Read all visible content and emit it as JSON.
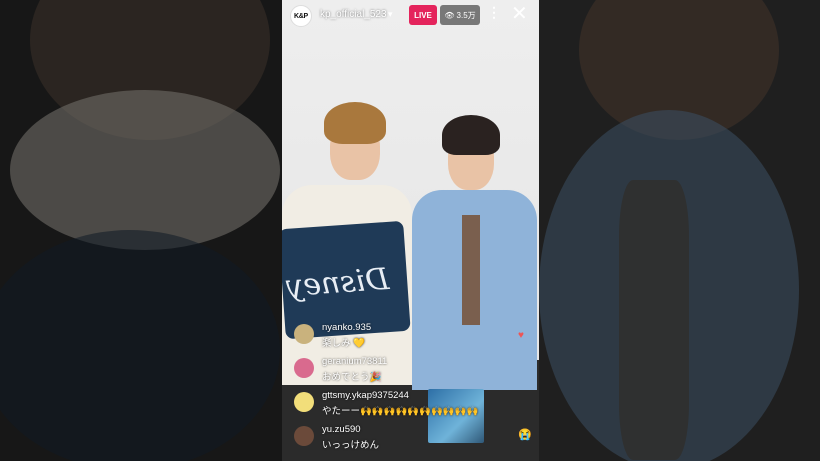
{
  "stream": {
    "avatar_text": "K&P",
    "username": "kp_official_523",
    "live_label": "LIVE",
    "viewer_count": "3.5万",
    "icons": {
      "dropdown": "chevron-down-icon",
      "viewers": "eye-icon",
      "more": "more-vertical-icon",
      "close": "close-icon"
    }
  },
  "pillow_text": "Disney",
  "comments": [
    {
      "user": "nyanko.935",
      "text": "楽しみ 💛",
      "avatar_color": "#c9b27d"
    },
    {
      "user": "geranium73811",
      "text": "おめでとう🎉",
      "avatar_color": "#d96a8e"
    },
    {
      "user": "gttsmy.ykap9375244",
      "text": "やたーー🙌🙌🙌🙌🙌🙌🙌🙌🙌🙌",
      "avatar_color": "#f2de7a"
    },
    {
      "user": "yu.zu590",
      "text": "いっっけめん",
      "avatar_color": "#6b4a3a"
    }
  ],
  "reaction_emoji": "😭",
  "colors": {
    "live_badge": "#e4245c",
    "pillow": "#1f3a57"
  }
}
